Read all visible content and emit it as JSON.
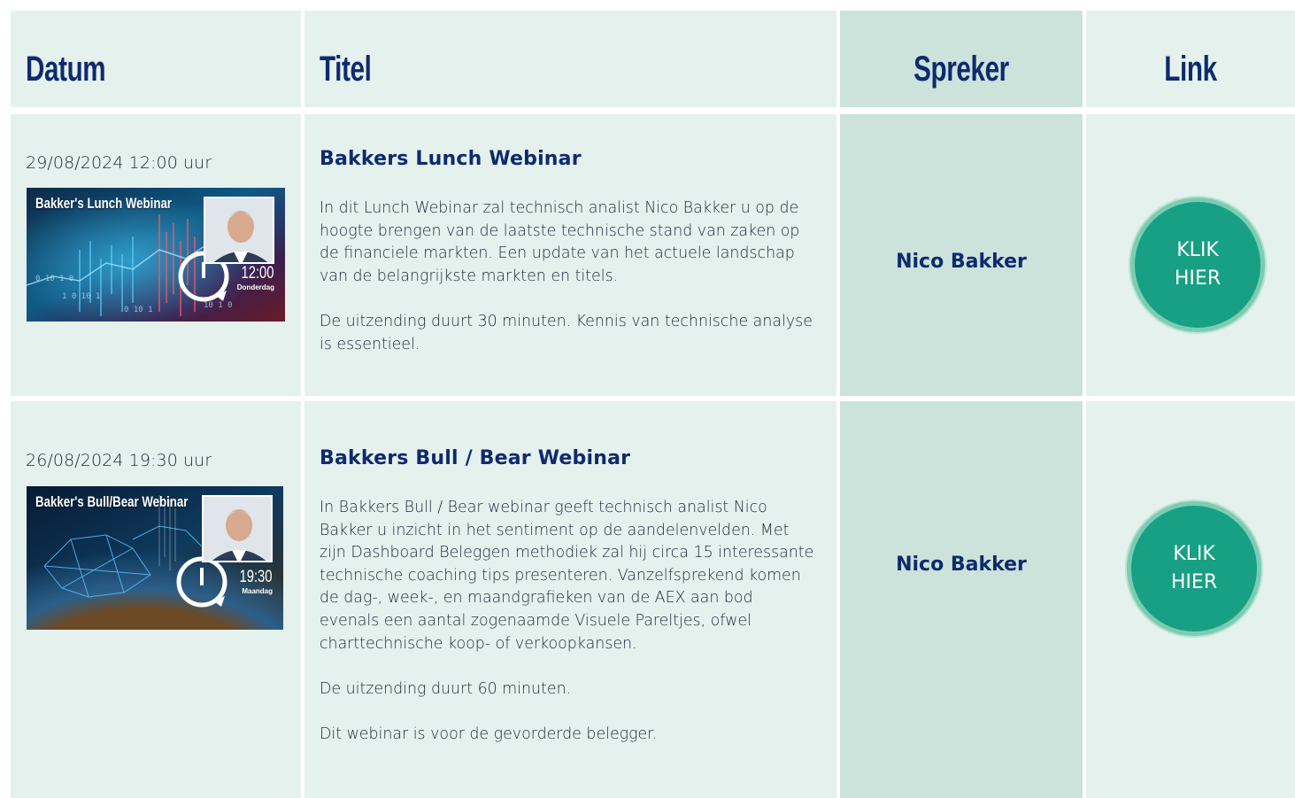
{
  "headers": {
    "datum": "Datum",
    "titel": "Titel",
    "spreker": "Spreker",
    "link": "Link"
  },
  "webinars": [
    {
      "date": "29/08/2024 12:00 uur",
      "thumbnail": {
        "title": "Bakker's Lunch Webinar",
        "time": "12:00",
        "day": "Donderdag"
      },
      "title": "Bakkers Lunch Webinar",
      "description": [
        "In dit Lunch Webinar zal technisch analist Nico Bakker u op de hoogte brengen van de laatste technische stand van zaken op de financiele markten. Een update van het actuele landschap van de belangrijkste markten en titels.",
        "De uitzending duurt 30 minuten. Kennis van technische analyse is essentieel."
      ],
      "speaker": "Nico Bakker",
      "link_label_line1": "KLIK",
      "link_label_line2": "HIER"
    },
    {
      "date": "26/08/2024 19:30 uur",
      "thumbnail": {
        "title": "Bakker's Bull/Bear Webinar",
        "time": "19:30",
        "day": "Maandag"
      },
      "title": "Bakkers Bull / Bear Webinar",
      "description": [
        "In Bakkers Bull / Bear webinar geeft technisch analist Nico Bakker u inzicht in het sentiment op de aandelenvelden. Met zijn Dashboard Beleggen methodiek zal hij circa 15 interessante technische coaching tips presenteren. Vanzelfsprekend komen de dag-, week-, en maandgrafieken van de AEX aan bod evenals een aantal zogenaamde Visuele Pareltjes, ofwel charttechnische koop- of verkoopkansen.",
        "De uitzending duurt 60 minuten.",
        "Dit webinar is voor de gevorderde belegger."
      ],
      "speaker": "Nico Bakker",
      "link_label_line1": "KLIK",
      "link_label_line2": "HIER"
    }
  ],
  "colors": {
    "cell_bg": "#e5f1ed",
    "speaker_bg": "#cbe3db",
    "heading": "#0e2a6e",
    "button": "#17a084",
    "button_ring": "#7dccb2"
  }
}
